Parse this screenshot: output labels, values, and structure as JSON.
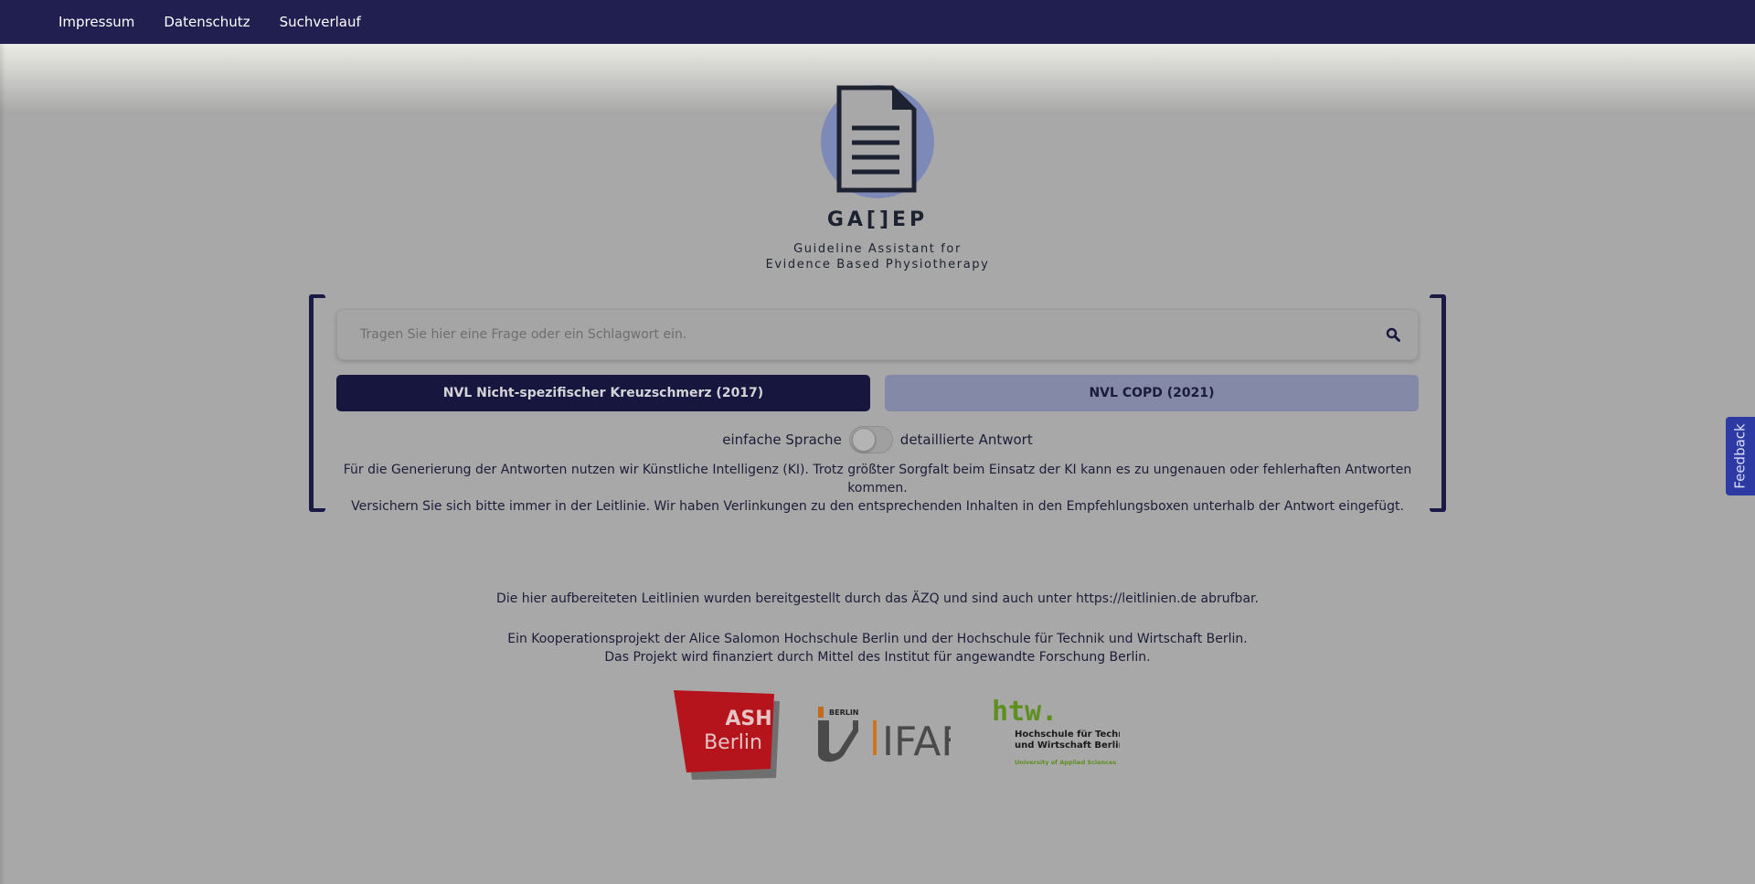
{
  "nav": {
    "items": [
      "Impressum",
      "Datenschutz",
      "Suchverlauf"
    ]
  },
  "brand": {
    "title": "GA[]EP",
    "subtitle_line1": "Guideline Assistant for",
    "subtitle_line2": "Evidence Based Physiotherapy",
    "icon": "document-icon"
  },
  "search": {
    "placeholder": "Tragen Sie hier eine Frage oder ein Schlagwort ein.",
    "value": "",
    "icon": "search-icon"
  },
  "guidelines": [
    {
      "label": "NVL Nicht-spezifischer Kreuzschmerz (2017)",
      "selected": true
    },
    {
      "label": "NVL COPD (2021)",
      "selected": false
    }
  ],
  "answer_mode": {
    "left_label": "einfache Sprache",
    "right_label": "detaillierte Antwort",
    "detailed": false
  },
  "disclaimer": {
    "line1": "Für die Generierung der Antworten nutzen wir Künstliche Intelligenz (KI). Trotz größter Sorgfalt beim Einsatz der KI kann es zu ungenauen oder fehlerhaften Antworten kommen.",
    "line2": "Versichern Sie sich bitte immer in der Leitlinie. Wir haben Verlinkungen zu den entsprechenden Inhalten in den Empfehlungsboxen unterhalb der Antwort eingefügt."
  },
  "footer": {
    "source": "Die hier aufbereiteten Leitlinien wurden bereitgestellt durch das ÄZQ und sind auch unter https://leitlinien.de abrufbar.",
    "coop_line1": "Ein Kooperationsprojekt der Alice Salomon Hochschule Berlin und der Hochschule für Technik und Wirtschaft Berlin.",
    "coop_line2": "Das Projekt wird finanziert durch Mittel des Institut für angewandte Forschung Berlin."
  },
  "partners": {
    "ash": {
      "line1": "ASH",
      "line2": "Berlin"
    },
    "ifaf": {
      "small": "BERLIN",
      "name": "IFAF"
    },
    "htw": {
      "name": "htw.",
      "line1": "Hochschule für Technik",
      "line2": "und Wirtschaft Berlin",
      "tagline": "University of Applied Sciences"
    }
  },
  "feedback": {
    "label": "Feedback"
  },
  "colors": {
    "nav_bg": "#211f50",
    "accent_dark": "#17163f",
    "accent_light": "#8389a7",
    "feedback_bg": "#2d3aa3",
    "ash_red": "#b5141c",
    "htw_green": "#76b82a",
    "ifaf_orange": "#e07a1f"
  }
}
